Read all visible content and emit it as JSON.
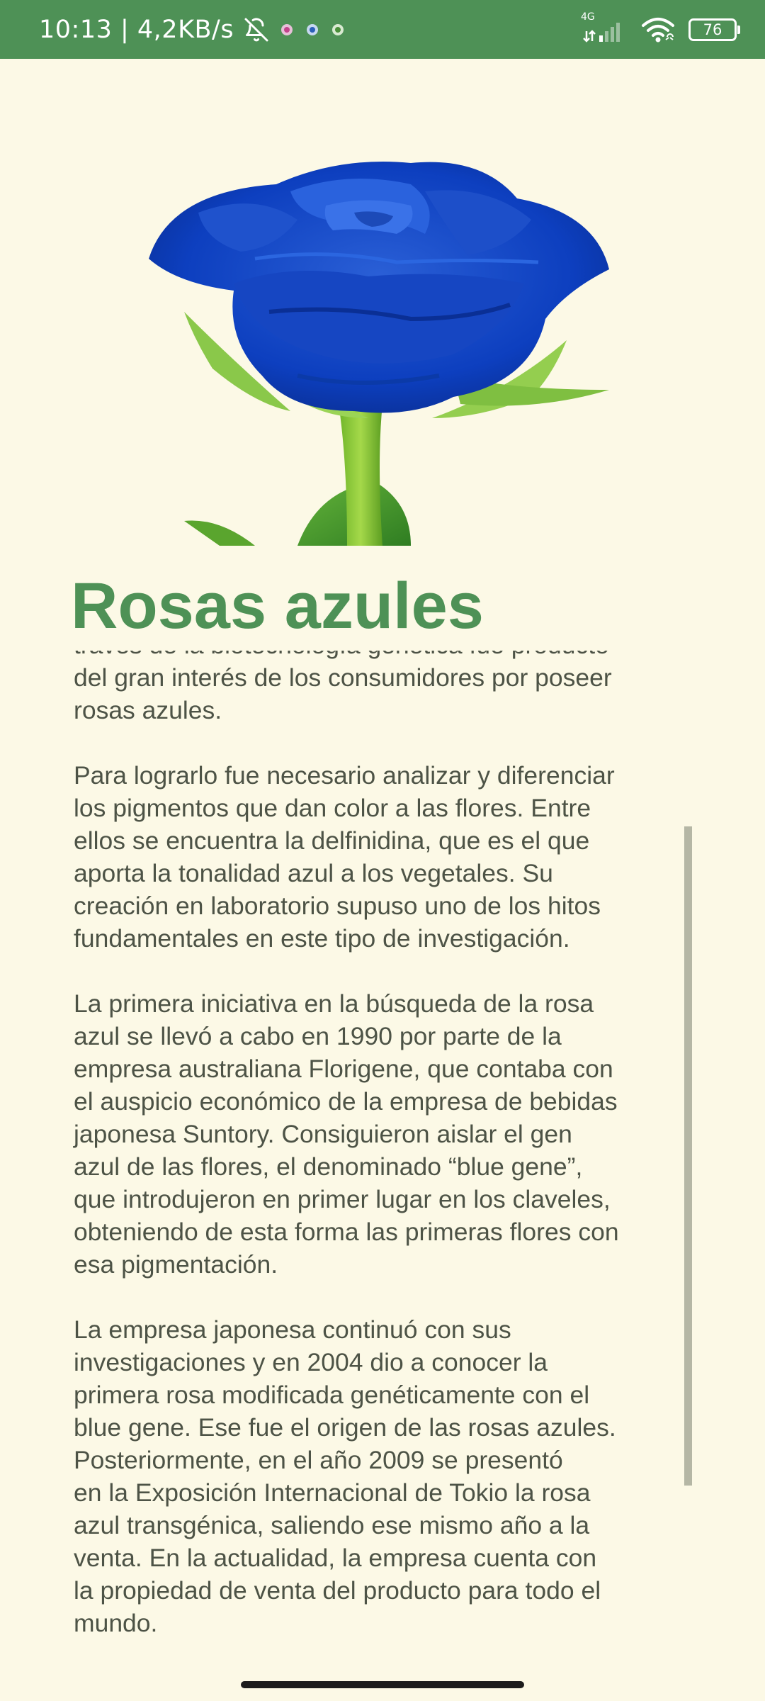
{
  "status_bar": {
    "time": "10:13 | 4,2KB/s",
    "network": "4G",
    "battery": "76",
    "icons": [
      "bell-off-icon",
      "app-notification-icon",
      "app-notification-icon",
      "app-notification-icon",
      "signal-icon",
      "wifi-icon",
      "battery-icon"
    ],
    "background_color": "#4E9156"
  },
  "hero_image": {
    "icon": "blue-rose-image"
  },
  "article": {
    "title": "Rosas azules",
    "paragraphs": [
      "través de la biotecnología genética fue producto\ndel gran interés de los consumidores por poseer\nrosas azules.",
      "Para lograrlo fue necesario analizar y diferenciar\nlos pigmentos que dan color a las flores. Entre\nellos se encuentra la delfinidina, que es el que\naporta la tonalidad azul a los vegetales. Su\ncreación en laboratorio supuso uno de los hitos\nfundamentales en este tipo de investigación.",
      "La primera iniciativa en la búsqueda de la rosa\nazul se llevó a cabo en 1990 por parte de la\nempresa australiana Florigene, que contaba con\nel auspicio económico de la empresa de bebidas\njaponesa Suntory. Consiguieron aislar el gen\nazul de las flores, el denominado “blue gene”,\nque introdujeron en primer lugar en los claveles,\nobteniendo de esta forma las primeras flores con\nesa pigmentación.",
      "La empresa japonesa continuó con sus\ninvestigaciones y en 2004 dio a conocer la\nprimera rosa modificada genéticamente con el\nblue gene. Ese fue el origen de las rosas azules.\nPosteriormente, en el año 2009 se presentó\nen la Exposición Internacional de Tokio la rosa\nazul transgénica, saliendo ese mismo año a la\nventa. En la actualidad, la empresa cuenta con\nla propiedad de venta del producto para todo el\nmundo."
    ]
  },
  "colors": {
    "page_background": "#FCF9E6",
    "title": "#4E9156",
    "body_text": "#4d5346",
    "scrollbar": "#B5B7A5"
  }
}
